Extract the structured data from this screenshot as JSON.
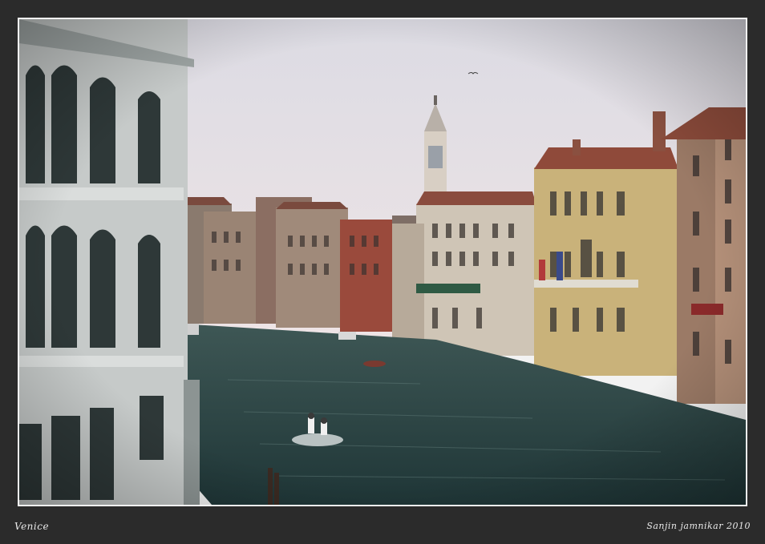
{
  "caption": {
    "title": "Venice",
    "credit": "Sanjin jamnikar  2010"
  },
  "colors": {
    "background": "#2b2b2b",
    "border": "#f2f2f2",
    "sky": "#e9e7ee",
    "water": "#2e4a4a"
  }
}
